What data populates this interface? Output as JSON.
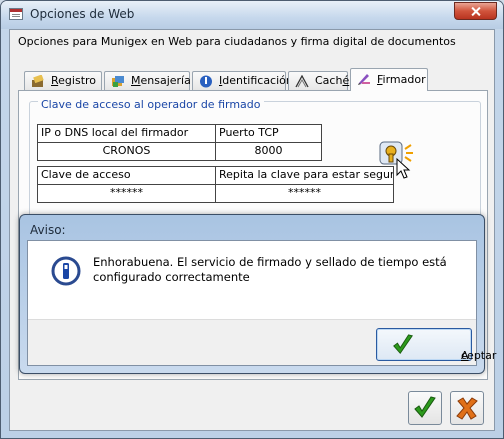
{
  "window": {
    "title": "Opciones de Web"
  },
  "description": "Opciones para Munigex en Web para ciudadanos y firma digital de documentos",
  "tabs": [
    {
      "label": "Registro",
      "hotkey": "R",
      "rest": "egistro",
      "icon": "registry-icon"
    },
    {
      "label": "Mensajería",
      "hotkey": "M",
      "rest": "ensajería",
      "icon": "messaging-icon"
    },
    {
      "label": "Identificación",
      "hotkey": "I",
      "rest": "dentificación",
      "icon": "identification-icon"
    },
    {
      "label": "Caché",
      "prefix": "Cach",
      "hotkey": "é",
      "rest": "",
      "icon": "cache-icon"
    },
    {
      "label": "Firmador",
      "hotkey": "F",
      "rest": "irmador",
      "icon": "signer-icon",
      "active": true
    }
  ],
  "group": {
    "title": "Clave de acceso al operador de firmado"
  },
  "fields": {
    "host_label": "IP o DNS local del firmador",
    "host_value": "CRONOS",
    "port_label": "Puerto TCP",
    "port_value": "8000",
    "key_label": "Clave de acceso",
    "key_value": "******",
    "key_repeat_label": "Repita la clave para estar seguro",
    "key_repeat_value": "******"
  },
  "dialog": {
    "title": "Aviso:",
    "message": "Enhorabuena. El servicio de firmado y sellado de tiempo está configurado correctamente",
    "accept_hotkey": "A",
    "accept_rest": "ceptar"
  },
  "colors": {
    "accent": "#1a46a6",
    "ok_green": "#2c9a1c",
    "cancel_orange": "#e07018"
  }
}
